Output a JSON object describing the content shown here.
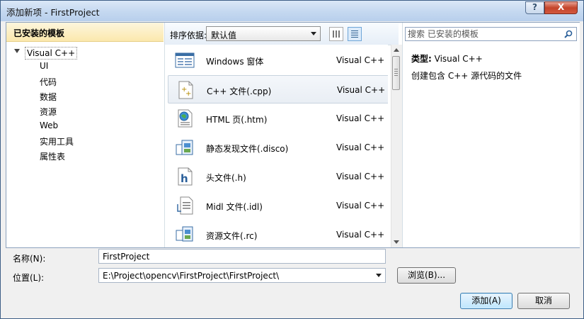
{
  "window": {
    "title": "添加新项 - FirstProject",
    "help_label": "?",
    "close_label": "X"
  },
  "left_panel": {
    "header": "已安装的模板",
    "root": "Visual C++",
    "items": [
      "UI",
      "代码",
      "数据",
      "资源",
      "Web",
      "实用工具",
      "属性表"
    ]
  },
  "toolbar": {
    "sort_label": "排序依据:",
    "sort_value": "默认值"
  },
  "templates": [
    {
      "name": "Windows 窗体",
      "type": "Visual C++",
      "icon": "windows-form-icon",
      "selected": false
    },
    {
      "name": "C++ 文件(.cpp)",
      "type": "Visual C++",
      "icon": "cpp-file-icon",
      "selected": true
    },
    {
      "name": "HTML 页(.htm)",
      "type": "Visual C++",
      "icon": "html-page-icon",
      "selected": false
    },
    {
      "name": "静态发现文件(.disco)",
      "type": "Visual C++",
      "icon": "disco-file-icon",
      "selected": false
    },
    {
      "name": "头文件(.h)",
      "type": "Visual C++",
      "icon": "header-file-icon",
      "selected": false
    },
    {
      "name": "Midl 文件(.idl)",
      "type": "Visual C++",
      "icon": "idl-file-icon",
      "selected": false
    },
    {
      "name": "资源文件(.rc)",
      "type": "Visual C++",
      "icon": "resource-file-icon",
      "selected": false
    }
  ],
  "search": {
    "placeholder": "搜索 已安装的模板"
  },
  "details": {
    "type_label": "类型:",
    "type_value": "Visual C++",
    "description": "创建包含 C++ 源代码的文件"
  },
  "form": {
    "name_label": "名称(N):",
    "name_value": "FirstProject",
    "location_label": "位置(L):",
    "location_value": "E:\\Project\\opencv\\FirstProject\\FirstProject\\",
    "browse_label": "浏览(B)..."
  },
  "buttons": {
    "add": "添加(A)",
    "cancel": "取消"
  }
}
